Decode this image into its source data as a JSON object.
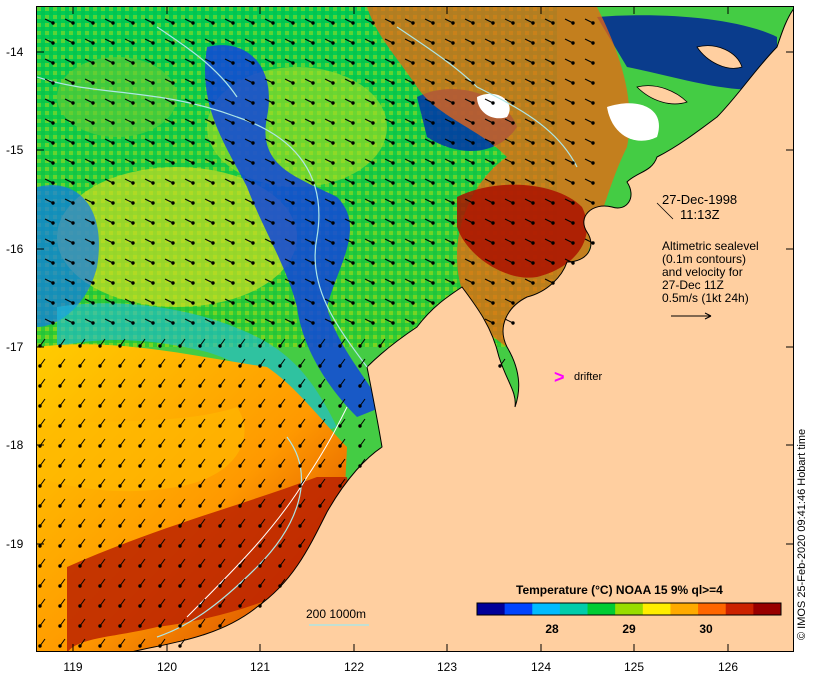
{
  "map": {
    "lat_ticks": [
      "-14",
      "-15",
      "-16",
      "-17",
      "-18",
      "-19"
    ],
    "lon_ticks": [
      "119",
      "120",
      "121",
      "122",
      "123",
      "124",
      "125",
      "126"
    ],
    "colors": {
      "land": "#ffcfa0",
      "coastline": "#000000",
      "contour": "#aee6e6",
      "arrow": "#000000",
      "drifter": "#ff00ff"
    }
  },
  "annotations": {
    "date": "27-Dec-1998",
    "time": "11:13Z",
    "altimetry_lines": [
      "Altimetric sealevel",
      "(0.1m contours)",
      "and velocity for",
      "27-Dec 11Z",
      "0.5m/s (1kt 24h)"
    ],
    "drifter_label": "drifter",
    "drifter_symbol": ">",
    "depth_label": "200  1000m"
  },
  "colorbar": {
    "title": "Temperature (°C) NOAA 15 9% ql>=4",
    "ticks": [
      "28",
      "29",
      "30"
    ],
    "colors": [
      "#000099",
      "#0044ff",
      "#00bbff",
      "#00ccaa",
      "#00cc33",
      "#99dd00",
      "#ffee00",
      "#ffaa00",
      "#ff6600",
      "#cc2200",
      "#990000"
    ]
  },
  "credit": "© IMOS 25-Feb-2020 09:41:46 Hobart time"
}
